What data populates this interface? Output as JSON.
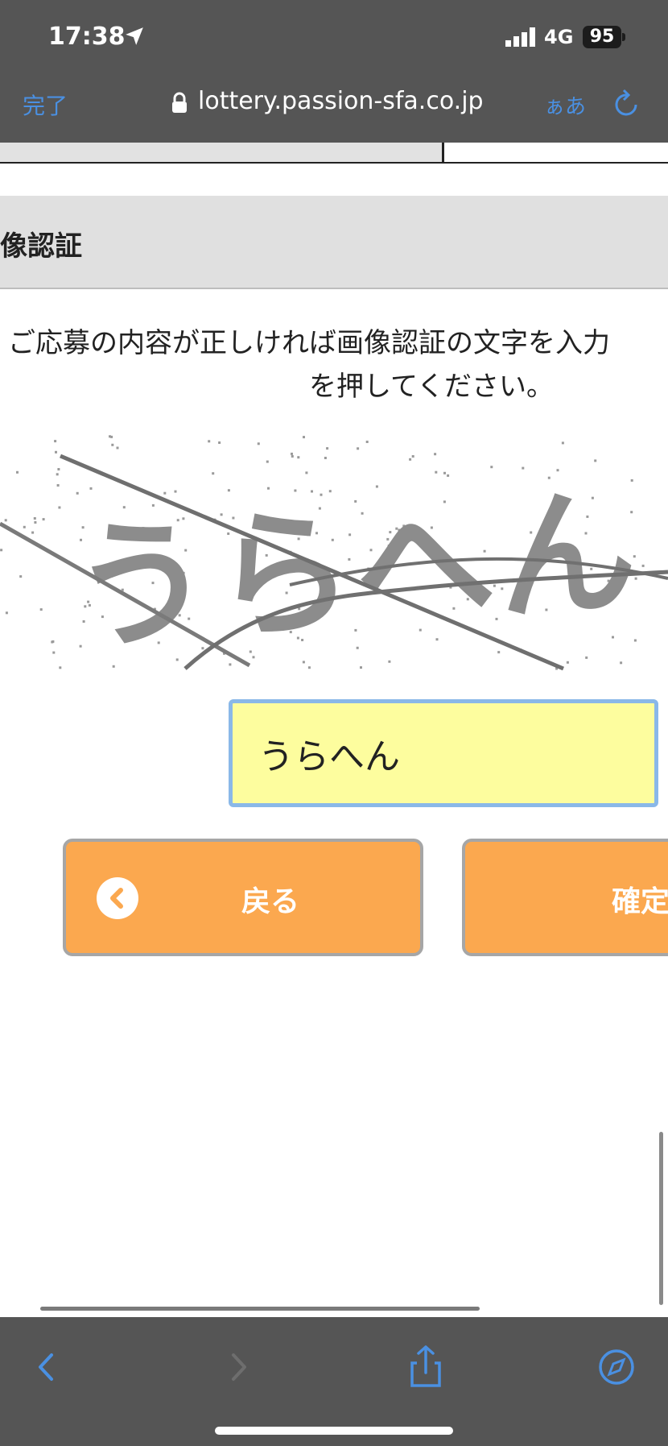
{
  "status_bar": {
    "time": "17:38",
    "network": "4G",
    "battery": "95"
  },
  "browser": {
    "done_label": "完了",
    "url": "lottery.passion-sfa.co.jp",
    "text_size_label": "ぁあ"
  },
  "section": {
    "title": "像認証"
  },
  "instructions": {
    "line1": "ご応募の内容が正しければ画像認証の文字を入力",
    "line2": "を押してください。"
  },
  "captcha": {
    "text": "うらへん"
  },
  "form": {
    "captcha_input_value": "うらへん"
  },
  "buttons": {
    "back_label": "戻る",
    "confirm_label": "確定"
  },
  "icons": {
    "location": "location-arrow-icon",
    "signal": "signal-bars-icon",
    "lock": "lock-icon",
    "reload": "reload-icon",
    "back_chevron": "chevron-left-circle-icon",
    "nav_back": "chevron-left-icon",
    "nav_forward": "chevron-right-icon",
    "share": "share-icon",
    "safari": "compass-icon"
  },
  "colors": {
    "accent": "#4a90e2",
    "button": "#fba84f",
    "input_bg": "#fdfd9e",
    "bar": "#555555"
  }
}
